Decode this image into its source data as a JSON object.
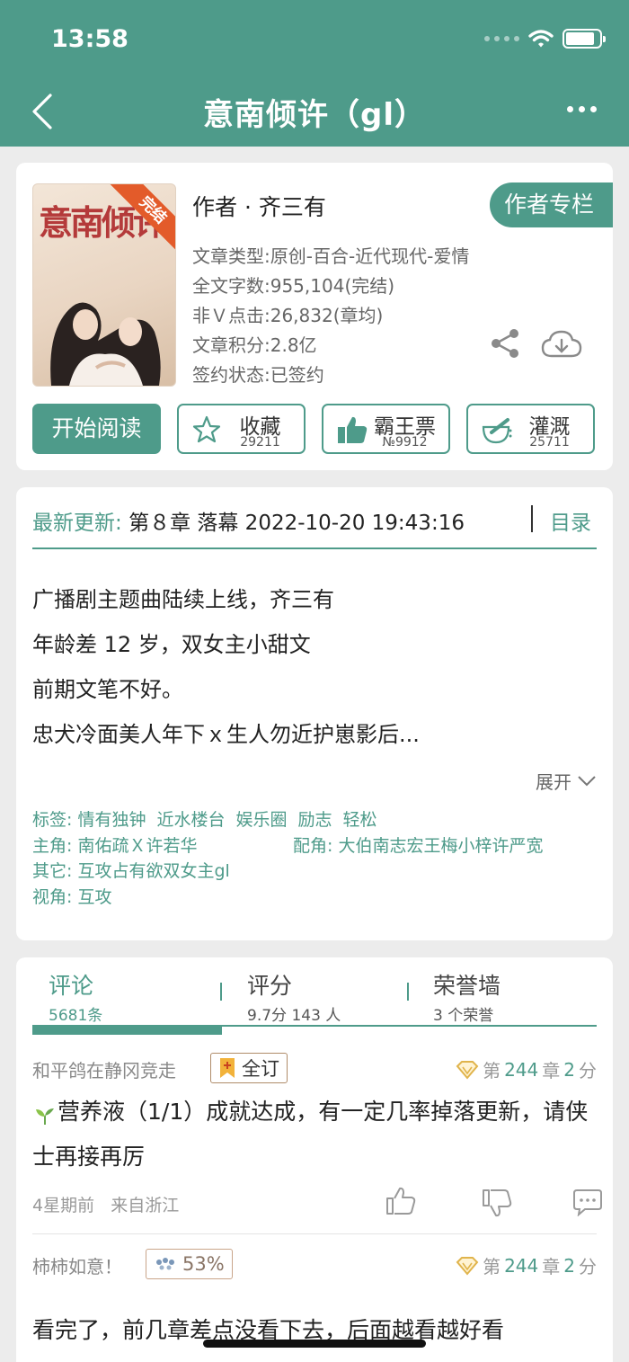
{
  "status_bar": {
    "time": "13:58",
    "battery_level": 0.85
  },
  "nav": {
    "title": "意南倾许（gl）",
    "back_icon": "chevron-left-icon",
    "more_icon": "more-horizontal-icon"
  },
  "book": {
    "cover_title": "意南倾许",
    "cover_ribbon": "完结",
    "author_line": "作者 · 齐三有",
    "author_column_button": "作者专栏",
    "meta": [
      "文章类型:原创-百合-近代现代-爱情",
      "全文字数:955,104(完结)",
      "非Ｖ点击:26,832(章均)",
      "文章积分:2.8亿",
      "签约状态:已签约"
    ],
    "actions": {
      "read": "开始阅读",
      "collect": {
        "label": "收藏",
        "count": "29211",
        "icon": "star-icon"
      },
      "ticket": {
        "label": "霸王票",
        "count": "№9912",
        "icon": "thumbs-up-icon"
      },
      "water": {
        "label": "灌溉",
        "count": "25711",
        "icon": "watering-icon"
      }
    }
  },
  "update": {
    "label": "最新更新:",
    "value": "第８章 落幕 2022-10-20 19:43:16",
    "toc": "目录",
    "intro": [
      "广播剧主题曲陆续上线，齐三有",
      "年龄差 12 岁，双女主小甜文",
      "前期文笔不好。",
      "忠犬冷面美人年下ｘ生人勿近护崽影后..."
    ],
    "expand": "展开",
    "tags_label": "标签:",
    "tags": [
      "情有独钟",
      "近水楼台",
      "娱乐圈",
      "励志",
      "轻松"
    ],
    "lead_label": "主角:",
    "lead": "南佑疏Ｘ许若华",
    "support_label": "配角:",
    "support": "大伯南志宏王梅小梓许严宽",
    "other_label": "其它:",
    "other": "互攻占有欲双女主gl",
    "view_label": "视角:",
    "view": "互攻"
  },
  "tabs": [
    {
      "label": "评论",
      "sub": "5681条"
    },
    {
      "label": "评分",
      "sub": "9.7分 143 人"
    },
    {
      "label": "荣誉墙",
      "sub": "3 个荣誉"
    }
  ],
  "comments": [
    {
      "user": "和平鸽在静冈竞走",
      "badge": "全订",
      "chapter_prefix": "第",
      "chapter": "244",
      "chapter_suffix": "章",
      "score": "2",
      "score_suffix": "分",
      "text": "营养液（1/1）成就达成，有一定几率掉落更新，请侠士再接再厉",
      "time": "4星期前",
      "location": "来自浙江"
    },
    {
      "user": "柿柿如意！",
      "badge": "53%",
      "chapter_prefix": "第",
      "chapter": "244",
      "chapter_suffix": "章",
      "score": "2",
      "score_suffix": "分",
      "text": "看完了，前几章差点没看下去，后面越看越好看"
    }
  ],
  "colors": {
    "primary": "#4e9b8a",
    "ribbon": "#e35b2a"
  }
}
